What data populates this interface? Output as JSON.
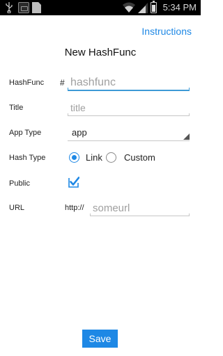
{
  "status_bar": {
    "time": "5:34 PM",
    "icons": [
      "usb-icon",
      "app-notification-icon",
      "sd-card-icon",
      "wifi-icon",
      "signal-icon",
      "battery-icon"
    ]
  },
  "header": {
    "instructions_label": "Instructions",
    "title": "New HashFunc"
  },
  "form": {
    "hashfunc": {
      "label": "HashFunc",
      "prefix": "#",
      "value": "",
      "placeholder": "hashfunc"
    },
    "title": {
      "label": "Title",
      "value": "",
      "placeholder": "title"
    },
    "app_type": {
      "label": "App Type",
      "value": "app"
    },
    "hash_type": {
      "label": "Hash Type",
      "options": [
        "Link",
        "Custom"
      ],
      "selected": "Link"
    },
    "public": {
      "label": "Public",
      "checked": true
    },
    "url": {
      "label": "URL",
      "prefix": "http://",
      "value": "",
      "placeholder": "someurl"
    }
  },
  "save_label": "Save",
  "colors": {
    "accent": "#1e88e5",
    "focus_underline": "#3d9ad6",
    "status_bar": "#000000"
  }
}
